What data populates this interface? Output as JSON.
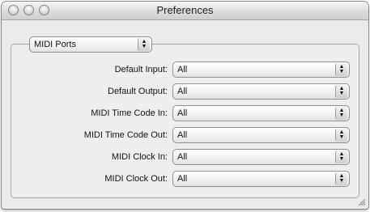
{
  "window": {
    "title": "Preferences"
  },
  "section_popup": {
    "value": "MIDI Ports"
  },
  "rows": [
    {
      "label": "Default Input:",
      "value": "All"
    },
    {
      "label": "Default Output:",
      "value": "All"
    },
    {
      "label": "MIDI Time Code In:",
      "value": "All"
    },
    {
      "label": "MIDI Time Code Out:",
      "value": "All"
    },
    {
      "label": "MIDI Clock In:",
      "value": "All"
    },
    {
      "label": "MIDI Clock Out:",
      "value": "All"
    }
  ],
  "icons": {
    "close": "close-button",
    "minimize": "minimize-button",
    "zoom": "zoom-button",
    "popup_arrows": "updown-arrows-icon",
    "resize": "resize-grip-icon"
  }
}
